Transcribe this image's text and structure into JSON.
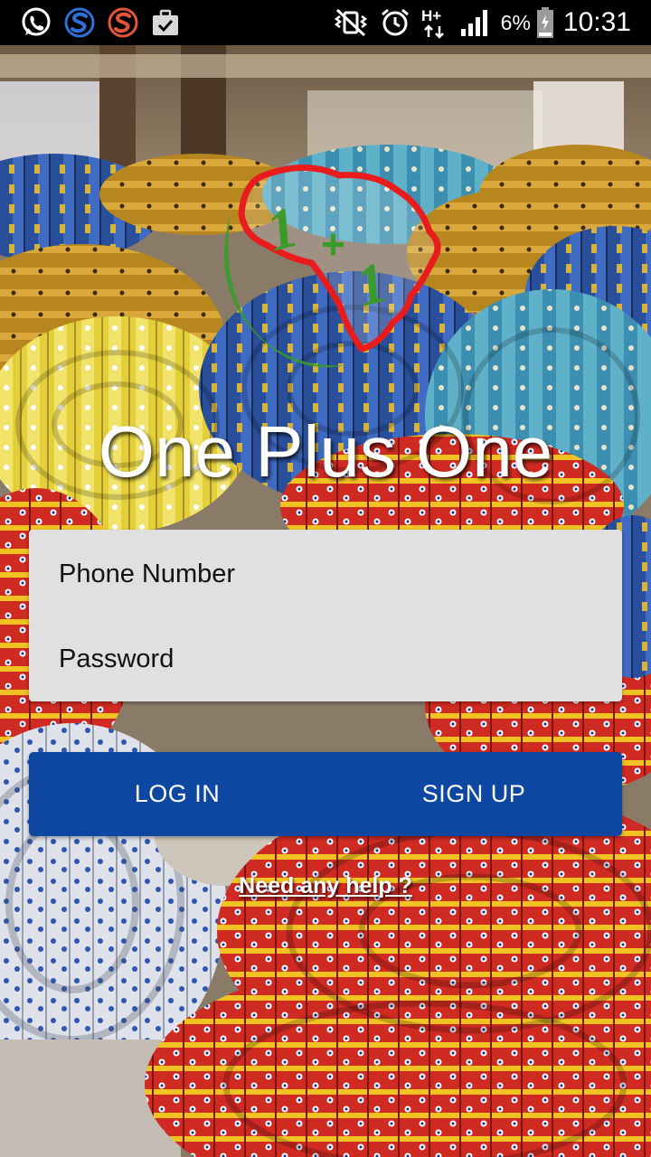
{
  "status_bar": {
    "left_icons": [
      "whatsapp-icon",
      "s-app-blue-icon",
      "s-app-orange-icon",
      "briefcase-check-icon"
    ],
    "right_icons": [
      "vibrate-mute-icon",
      "alarm-icon",
      "network-h-plus-icon",
      "signal-icon",
      "battery-icon"
    ],
    "battery_percent": "6%",
    "time": "10:31"
  },
  "logo": {
    "label": "1+1"
  },
  "title": "One Plus One",
  "form": {
    "phone_placeholder": "Phone Number",
    "password_placeholder": "Password"
  },
  "buttons": {
    "login_label": "LOG IN",
    "signup_label": "SIGN UP"
  },
  "help_link": "Need any help ?",
  "colors": {
    "status_bar": "#000000",
    "form_background": "#e0e0e0",
    "button_background": "#0d47a1",
    "logo_red": "#e81c1c",
    "logo_green": "#3a9b2a"
  }
}
